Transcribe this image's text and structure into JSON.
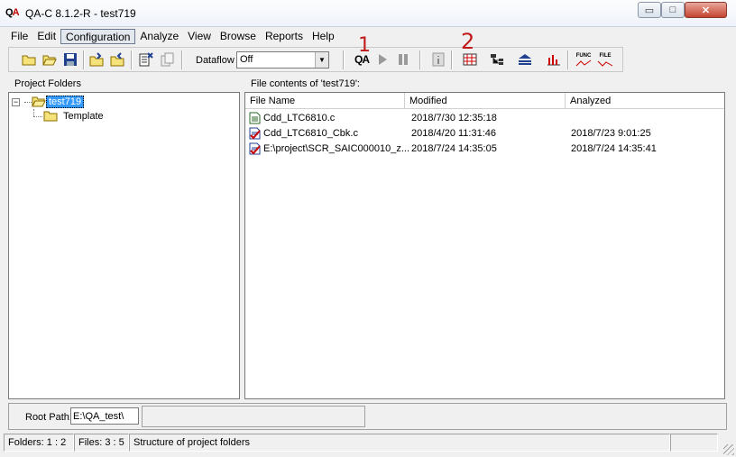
{
  "window": {
    "title": "QA-C 8.1.2-R - test719",
    "logo_q": "Q",
    "logo_a": "A",
    "min_glyph": "▭",
    "max_glyph": "□",
    "close_glyph": "✕"
  },
  "menu": {
    "items": [
      "File",
      "Edit",
      "Configuration",
      "Analyze",
      "View",
      "Browse",
      "Reports",
      "Help"
    ],
    "active_index": 2
  },
  "toolbar": {
    "dataflow_label": "Dataflow",
    "dataflow_value": "Off",
    "qa_button": "QA",
    "func_button": "FUNC",
    "file_button": "FILE",
    "icons": [
      "new-folder-icon",
      "open-folder-icon",
      "save-icon",
      "add-folder-icon",
      "remove-folder-icon",
      "properties-icon",
      "copy-icon",
      "qa-analyze-icon",
      "run-icon",
      "pause-icon",
      "info-icon",
      "report-grid-icon",
      "call-tree-icon",
      "structure-icon",
      "bar-chart-icon",
      "func-graph-icon",
      "file-graph-icon"
    ]
  },
  "left_panel": {
    "header": "Project Folders",
    "tree": [
      {
        "label": "test719",
        "selected": true,
        "expanded": true,
        "toggle": "−"
      },
      {
        "label": "Template",
        "selected": false
      }
    ]
  },
  "right_panel": {
    "header": "File contents of  'test719':",
    "columns": [
      "File Name",
      "Modified",
      "Analyzed"
    ],
    "rows": [
      {
        "name": "Cdd_LTC6810.c",
        "modified": "2018/7/30 12:35:18",
        "analyzed": "",
        "icon": "c-file-icon"
      },
      {
        "name": "Cdd_LTC6810_Cbk.c",
        "modified": "2018/4/20 11:31:46",
        "analyzed": "2018/7/23 9:01:25",
        "icon": "analyzed-file-icon"
      },
      {
        "name": "E:\\project\\SCR_SAIC000010_z...",
        "modified": "2018/7/24 14:35:05",
        "analyzed": "2018/7/24 14:35:41",
        "icon": "analyzed-file-icon"
      }
    ]
  },
  "root_path": {
    "label": "Root Path:",
    "value": "E:\\QA_test\\"
  },
  "status": {
    "folders": "Folders:  1 : 2",
    "files": "Files:  3 : 5",
    "message": "Structure of project folders"
  },
  "annotations": [
    "1",
    "2"
  ],
  "colors": {
    "selection": "#3399ff",
    "annotation": "#c01a1a",
    "close_button": "#c5442f"
  }
}
